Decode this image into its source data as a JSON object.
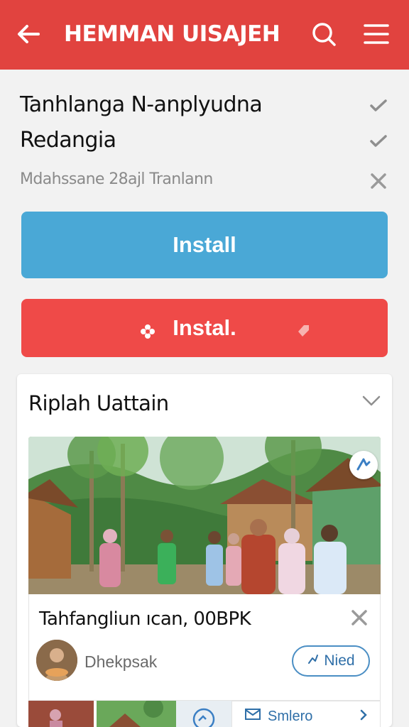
{
  "app_bar": {
    "title": "HEMMAN UISAJEH",
    "background": "#e1433f",
    "icons": [
      "back-arrow-icon",
      "search-icon",
      "menu-icon"
    ]
  },
  "details": {
    "line1": "Tanhlanga N-anplуudna",
    "line2": "Redangia",
    "line3": "Mdahssane 28ajl Tranlann",
    "line_marks": [
      "check-icon",
      "check-icon",
      "close-icon"
    ]
  },
  "buttons": {
    "install_primary": "Install",
    "install_secondary": "Instal."
  },
  "colors": {
    "accent_red": "#e1433f",
    "button_blue": "#4aa8d6",
    "button_red": "#ef4a48",
    "link_blue": "#2f6fa8"
  },
  "card": {
    "title": "Riplah Uattain",
    "item": {
      "title": "Tahfangliun ıcan, 00BPK",
      "author": "Dhekpsak",
      "pill_label": "Nied"
    },
    "mini_button": "Smlero"
  }
}
